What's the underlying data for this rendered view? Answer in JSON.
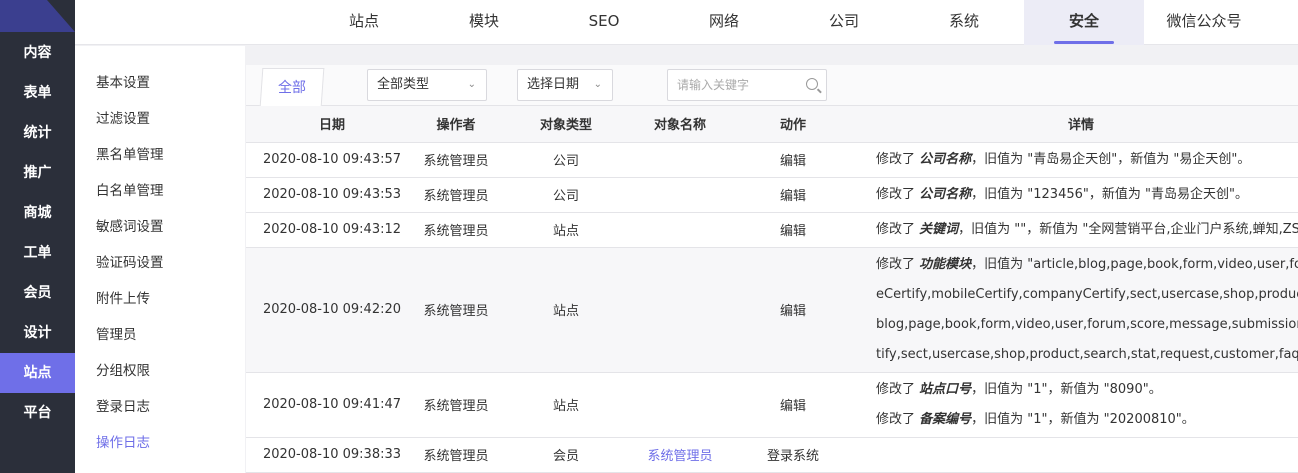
{
  "sidebar": {
    "items": [
      "内容",
      "表单",
      "统计",
      "推广",
      "商城",
      "工单",
      "会员",
      "设计",
      "站点",
      "平台"
    ],
    "active_index": 8
  },
  "topnav": {
    "tabs": [
      "站点",
      "模块",
      "SEO",
      "网络",
      "公司",
      "系统",
      "安全",
      "微信公众号"
    ],
    "active_index": 6
  },
  "submenu": {
    "items": [
      "基本设置",
      "过滤设置",
      "黑名单管理",
      "白名单管理",
      "敏感词设置",
      "验证码设置",
      "附件上传",
      "管理员",
      "分组权限",
      "登录日志",
      "操作日志"
    ],
    "active_index": 10
  },
  "filters": {
    "all_tab": "全部",
    "type_select": "全部类型",
    "date_select": "选择日期",
    "search_placeholder": "请输入关键字"
  },
  "table": {
    "headers": {
      "date": "日期",
      "operator": "操作者",
      "object_type": "对象类型",
      "object_name": "对象名称",
      "action": "动作",
      "detail": "详情"
    },
    "rows": [
      {
        "date": "2020-08-10 09:43:57",
        "operator": "系统管理员",
        "object_type": "公司",
        "object_name": "",
        "action": "编辑",
        "details": [
          [
            "修改了 ",
            "公司名称",
            "，旧值为 \"青岛易企天创\"，新值为 \"易企天创\"。"
          ]
        ]
      },
      {
        "date": "2020-08-10 09:43:53",
        "operator": "系统管理员",
        "object_type": "公司",
        "object_name": "",
        "action": "编辑",
        "details": [
          [
            "修改了 ",
            "公司名称",
            "，旧值为 \"123456\"，新值为 \"青岛易企天创\"。"
          ]
        ]
      },
      {
        "date": "2020-08-10 09:43:12",
        "operator": "系统管理员",
        "object_type": "站点",
        "object_name": "",
        "action": "编辑",
        "details": [
          [
            "修改了 ",
            "关键词",
            "，旧值为 \"\"，新值为 \"全网营销平台,企业门户系统,蝉知,ZSITE\"。"
          ]
        ]
      },
      {
        "date": "2020-08-10 09:42:20",
        "operator": "系统管理员",
        "object_type": "站点",
        "object_name": "",
        "action": "编辑",
        "details": [
          [
            "修改了 ",
            "功能模块",
            "，旧值为 \"article,blog,page,book,form,video,user,forum,score,message,submission,realnam"
          ],
          [
            "",
            "",
            "eCertify,mobileCertify,companyCertify,sect,usercase,shop,product,search,stat,customer,faq\"，新值为 \"article,"
          ],
          [
            "",
            "",
            "blog,page,book,form,video,user,forum,score,message,submission,realnameCertify,mobileCertify,companyCer"
          ],
          [
            "",
            "",
            "tify,sect,usercase,shop,product,search,stat,request,customer,faq\"。"
          ]
        ]
      },
      {
        "date": "2020-08-10 09:41:47",
        "operator": "系统管理员",
        "object_type": "站点",
        "object_name": "",
        "action": "编辑",
        "details": [
          [
            "修改了 ",
            "站点口号",
            "，旧值为 \"1\"，新值为 \"8090\"。"
          ],
          [
            "修改了 ",
            "备案编号",
            "，旧值为 \"1\"，新值为 \"20200810\"。"
          ]
        ]
      },
      {
        "date": "2020-08-10 09:38:33",
        "operator": "系统管理员",
        "object_type": "会员",
        "object_name": "系统管理员",
        "action": "登录系统",
        "details": []
      }
    ]
  },
  "colors": {
    "accent": "#6f6fe8",
    "sidebar_bg": "#2b2f3a"
  }
}
